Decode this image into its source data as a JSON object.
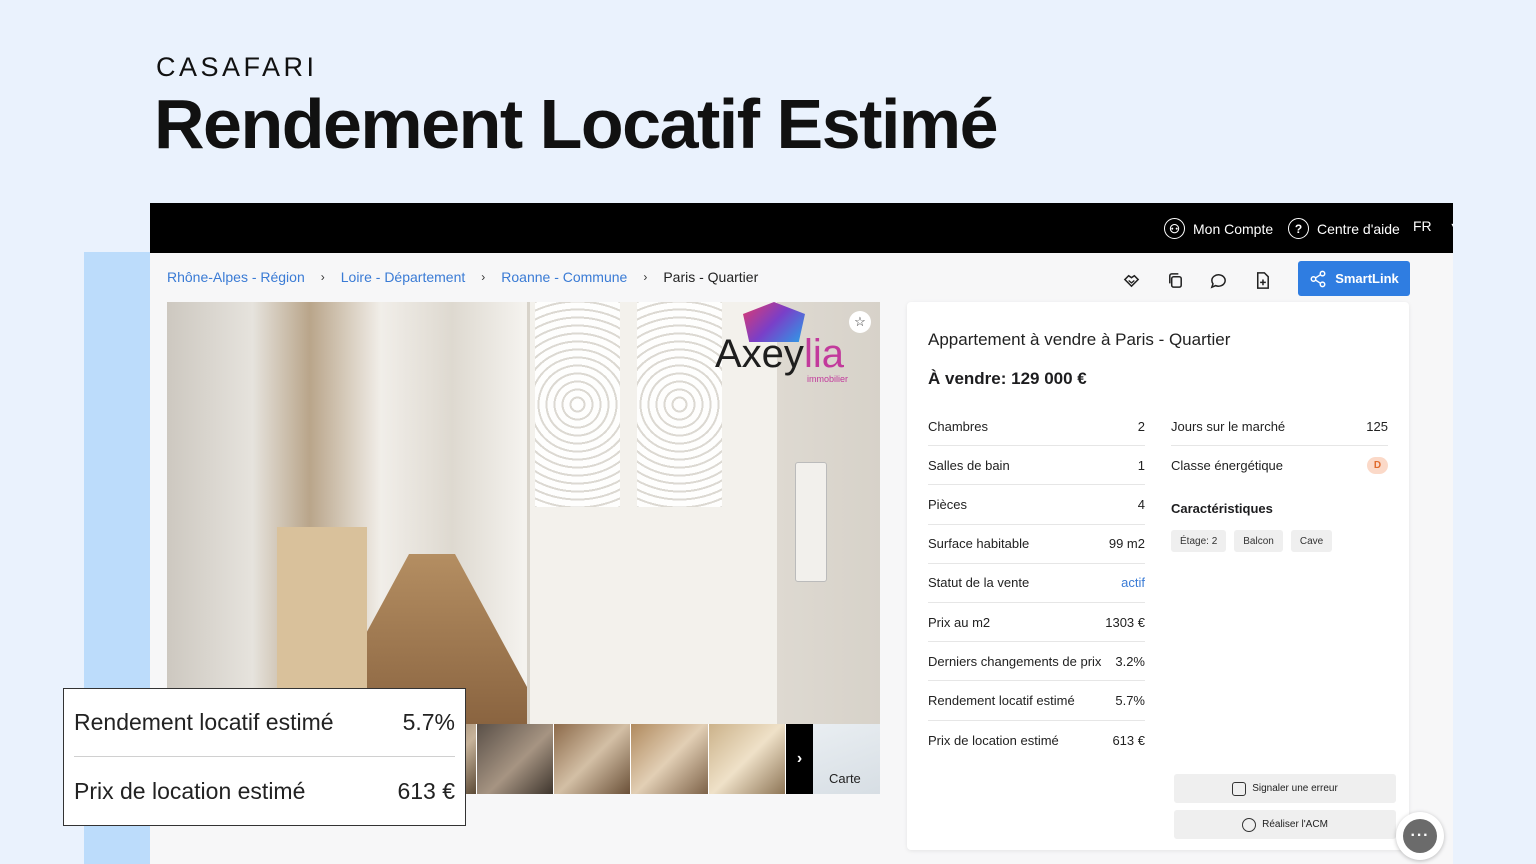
{
  "brand": "CASAFARI",
  "headline": "Rendement Locatif Estimé",
  "topbar": {
    "account": "Mon Compte",
    "help": "Centre d'aide",
    "lang": "FR"
  },
  "breadcrumbs": [
    "Rhône-Alpes - Région",
    "Loire - Département",
    "Roanne - Commune",
    "Paris - Quartier"
  ],
  "toolbar": {
    "icons": [
      "handshake-icon",
      "copy-icon",
      "comment-icon",
      "add-file-icon"
    ],
    "smartlink_label": "SmartLink"
  },
  "gallery": {
    "logo_text_1": "Axey",
    "logo_text_2": "lia",
    "logo_sub": "immobilier",
    "next": "›",
    "map_label": "Carte"
  },
  "listing": {
    "title": "Appartement à vendre à Paris - Quartier",
    "price": "À vendre: 129 000 €",
    "details_left": [
      {
        "label": "Chambres",
        "value": "2"
      },
      {
        "label": "Salles de bain",
        "value": "1"
      },
      {
        "label": "Pièces",
        "value": "4"
      },
      {
        "label": "Surface habitable",
        "value": "99 m2"
      },
      {
        "label": "Statut de la vente",
        "value": "actif"
      },
      {
        "label": "Prix au m2",
        "value": "1303 €"
      },
      {
        "label": "Derniers changements de prix",
        "value": "3.2%"
      },
      {
        "label": "Rendement locatif estimé",
        "value": "5.7%"
      },
      {
        "label": "Prix de location estimé",
        "value": "613 €"
      }
    ],
    "details_right": [
      {
        "label": "Jours sur le marché",
        "value": "125"
      },
      {
        "label": "Classe énergétique",
        "value": "D"
      }
    ],
    "features_title": "Caractéristiques",
    "features": [
      "Étage: 2",
      "Balcon",
      "Cave"
    ],
    "actions": [
      "Signaler une erreur",
      "Réaliser l'ACM"
    ]
  },
  "callout": {
    "yield_label": "Rendement locatif estimé",
    "yield_value": "5.7%",
    "rent_label": "Prix de location estimé",
    "rent_value": "613 €"
  },
  "colors": {
    "accent": "#2f7de1",
    "background": "#eaf2fd",
    "energy_badge": "#fbd9c8"
  }
}
